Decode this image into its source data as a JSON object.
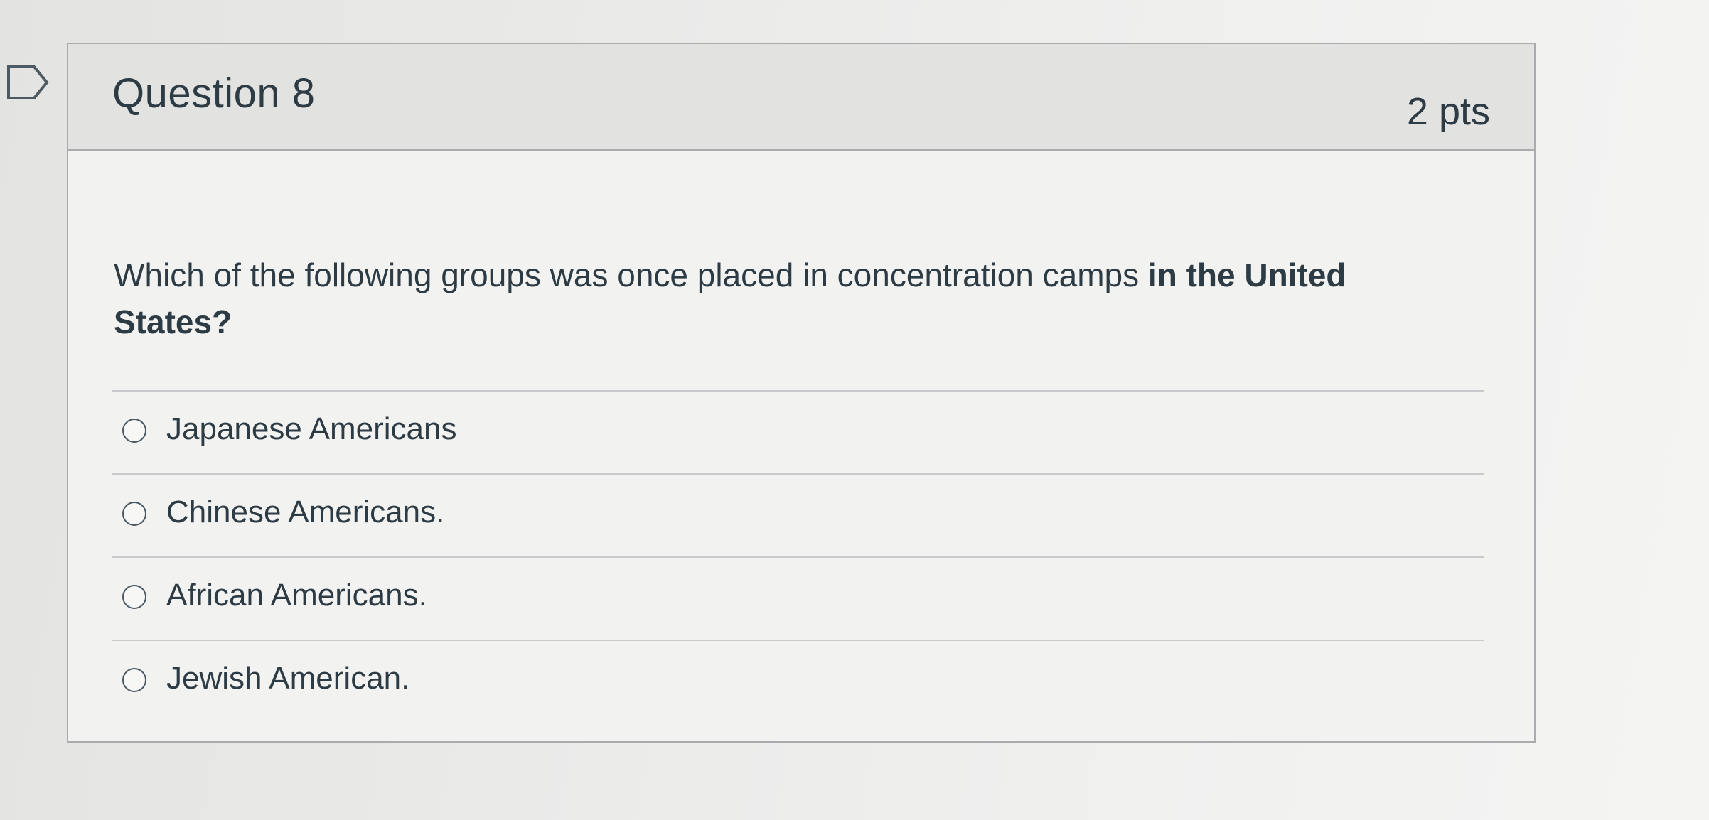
{
  "question": {
    "title": "Question 8",
    "points": "2 pts",
    "text_before_bold": "Which of the following groups was once placed in concentration camps ",
    "text_bold": "in the United States?",
    "answers": [
      {
        "label": "Japanese Americans"
      },
      {
        "label": "Chinese Americans."
      },
      {
        "label": "African Americans."
      },
      {
        "label": "Jewish American."
      }
    ]
  },
  "icons": {
    "flag": "bookmark-flag-icon",
    "radio": "radio-unselected-icon"
  }
}
